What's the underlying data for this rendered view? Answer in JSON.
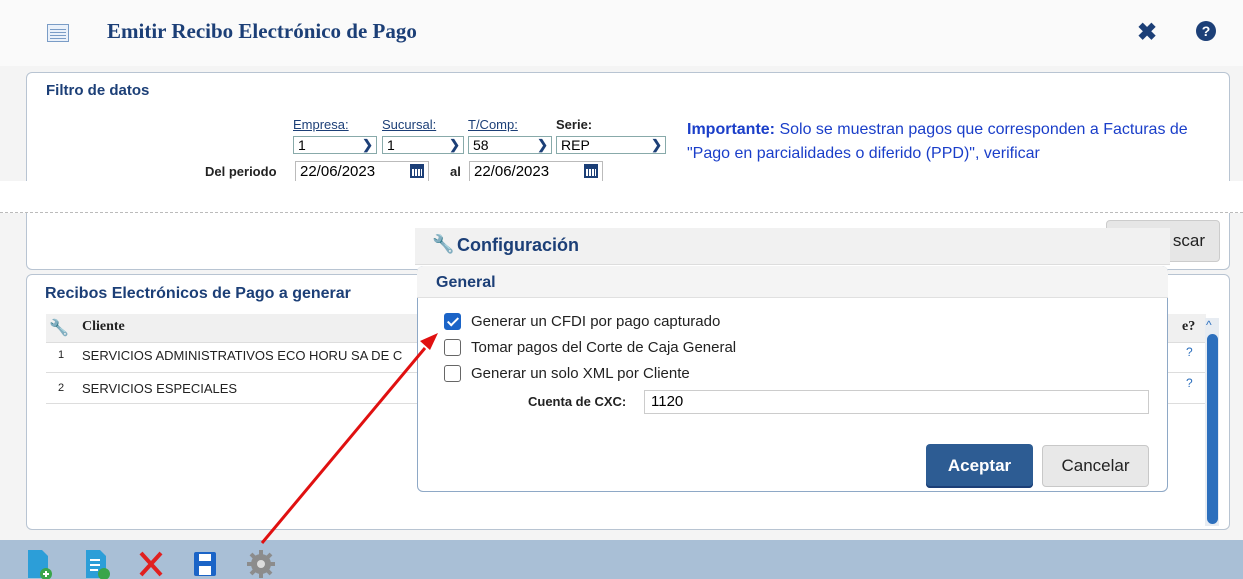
{
  "window": {
    "title": "Emitir Recibo Electrónico de Pago",
    "close": "✖",
    "help": "?"
  },
  "filter": {
    "title": "Filtro de datos",
    "empresa_label": "Empresa:",
    "empresa_value": "1",
    "sucursal_label": "Sucursal:",
    "sucursal_value": "1",
    "tcomp_label": "T/Comp:",
    "tcomp_value": "58",
    "serie_label": "Serie:",
    "serie_value": "REP",
    "periodo_label": "Del periodo",
    "fecha_inicio": "22/06/2023",
    "al_label": "al",
    "fecha_fin": "22/06/2023",
    "important_label": "Importante:",
    "important_text": " Solo se muestran pagos que corresponden a Facturas de \"Pago en parcialidades o diferido (PPD)\", verificar",
    "buscar_label": "scar"
  },
  "list": {
    "title": "Recibos Electrónicos de Pago a generar",
    "col_cliente": "Cliente",
    "col_right": "e?",
    "rows": [
      {
        "num": "1",
        "cliente": "SERVICIOS ADMINISTRATIVOS ECO HORU SA DE C"
      },
      {
        "num": "2",
        "cliente": "SERVICIOS ESPECIALES"
      }
    ]
  },
  "dialog": {
    "title": "Configuración",
    "group": "General",
    "opt1": "Generar un CFDI por pago capturado",
    "opt2": "Tomar pagos del Corte de Caja General",
    "opt3": "Generar un solo XML por Cliente",
    "opt1_checked": true,
    "opt2_checked": false,
    "opt3_checked": false,
    "cuenta_label": "Cuenta de CXC:",
    "cuenta_value": "1120",
    "accept": "Aceptar",
    "cancel": "Cancelar"
  },
  "toolbar_icons": [
    "new-document-icon",
    "new-list-icon",
    "delete-icon",
    "save-icon",
    "settings-gear-icon"
  ],
  "colors": {
    "navy": "#1c3f77",
    "link_blue": "#1a3ec9",
    "arrow_red": "#e01010",
    "accent": "#2d5c93"
  }
}
